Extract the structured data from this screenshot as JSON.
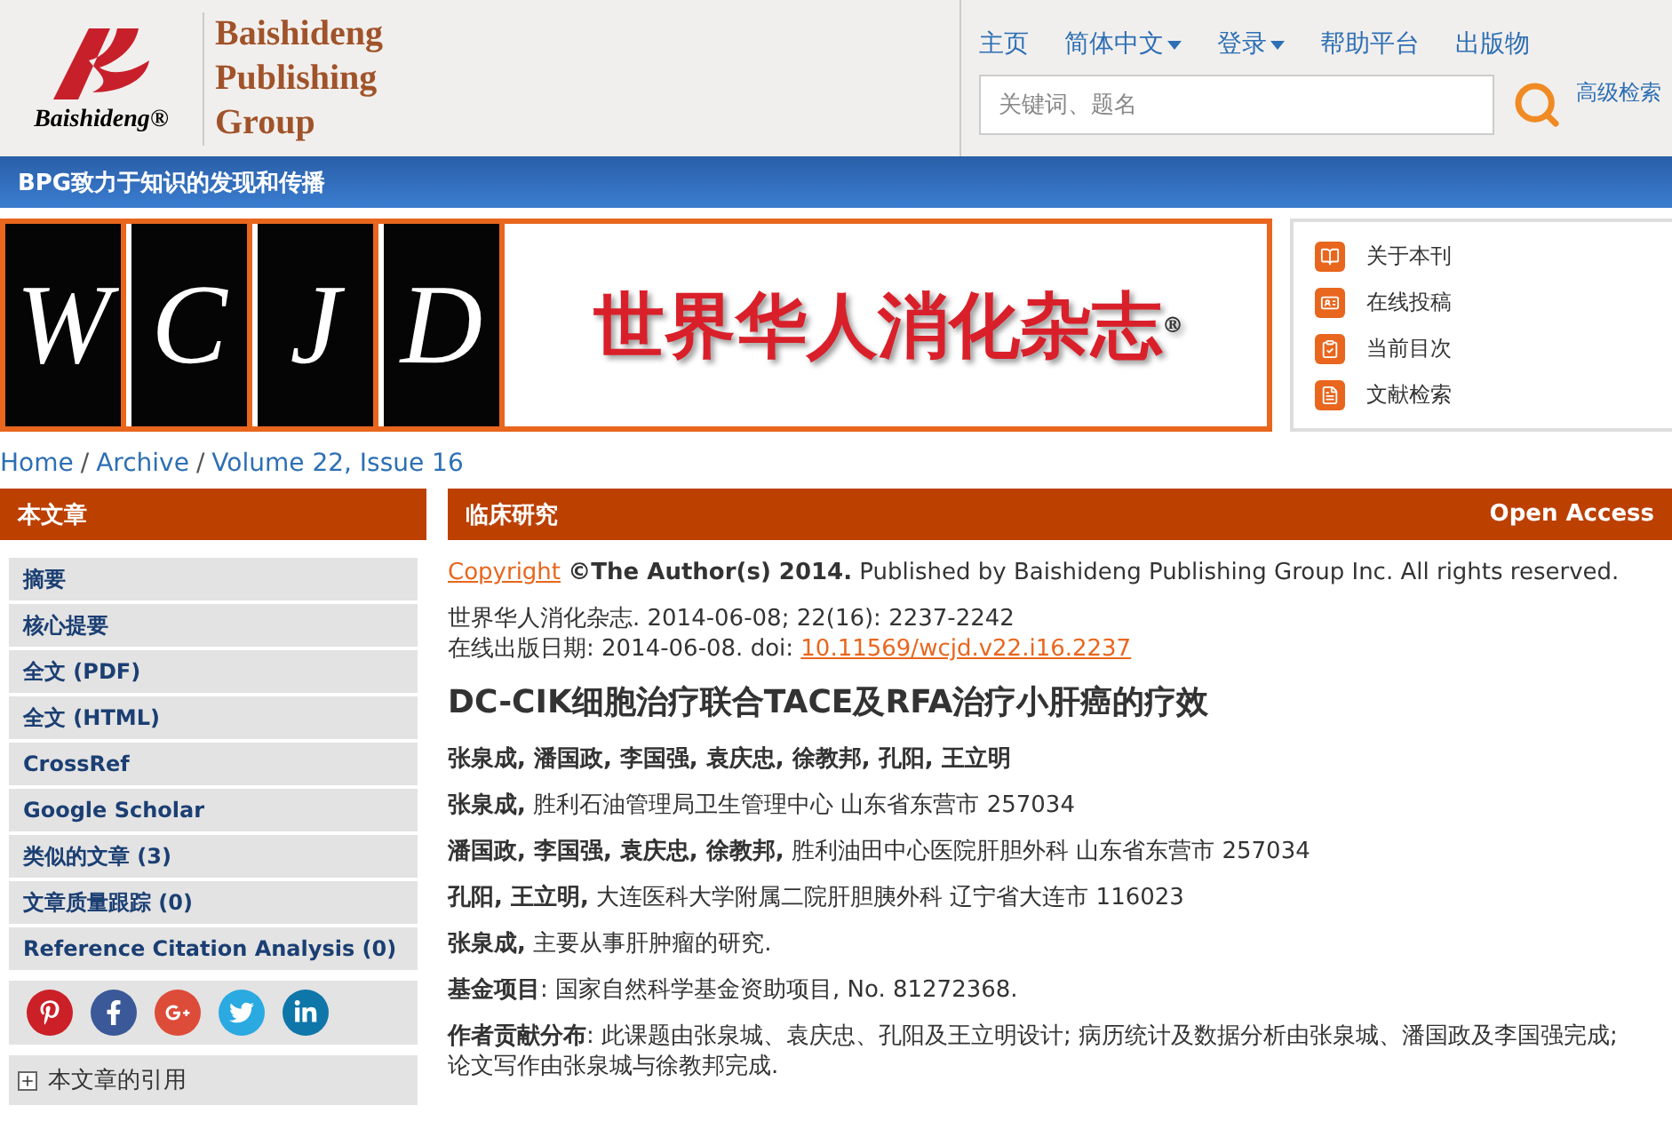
{
  "brand": {
    "logo_text": "Baishideng",
    "registered": "®",
    "name": [
      "Baishideng",
      "Publishing",
      "Group"
    ]
  },
  "nav": [
    {
      "label": "主页",
      "dropdown": false
    },
    {
      "label": "简体中文",
      "dropdown": true
    },
    {
      "label": "登录",
      "dropdown": true
    },
    {
      "label": "帮助平台",
      "dropdown": false
    },
    {
      "label": "出版物",
      "dropdown": false
    }
  ],
  "search": {
    "placeholder": "关键词、题名",
    "advanced": "高级检索"
  },
  "tagline": "BPG致力于知识的发现和传播",
  "banner": {
    "letters": [
      "W",
      "C",
      "J",
      "D"
    ],
    "title": "世界华人消化杂志",
    "registered": "®"
  },
  "journal_menu": [
    "关于本刊",
    "在线投稿",
    "当前目次",
    "文献检索"
  ],
  "breadcrumb": {
    "separator": "/",
    "items": [
      "Home",
      "Archive",
      "Volume 22, Issue 16"
    ]
  },
  "sidebar": {
    "title": "本文章",
    "items": [
      "摘要",
      "核心提要",
      "全文 (PDF)",
      "全文 (HTML)",
      "CrossRef",
      "Google Scholar",
      "类似的文章 (3)",
      "文章质量跟踪 (0)",
      "Reference Citation Analysis (0)"
    ],
    "sections": [
      {
        "label": "本文章的引用",
        "expanded": false
      }
    ]
  },
  "article": {
    "section": "临床研究",
    "access": "Open Access",
    "copyright_link": "Copyright",
    "copyright": "**©The Author(s) 2014.** Published by Baishideng Publishing Group Inc. All rights reserved.",
    "citation": "世界华人消化杂志. 2014-06-08; 22(16): 2237-2242",
    "online_date": "在线出版日期: 2014-06-08. doi: ",
    "doi": "10.11569/wcjd.v22.i16.2237",
    "title": "DC-CIK细胞治疗联合TACE及RFA治疗小肝癌的疗效",
    "paragraphs": [
      "**张泉成, 潘国政, 李国强, 袁庆忠, 徐教邦, 孔阳, 王立明**",
      "**张泉成,** 胜利石油管理局卫生管理中心 山东省东营市 257034",
      "**潘国政, 李国强, 袁庆忠, 徐教邦,** 胜利油田中心医院肝胆外科 山东省东营市 257034",
      "**孔阳, 王立明,** 大连医科大学附属二院肝胆胰外科 辽宁省大连市 116023",
      "**张泉成,** 主要从事肝肿瘤的研究.",
      "**基金项目**: 国家自然科学基金资助项目, No. 81272368.",
      "**作者贡献分布**: 此课题由张泉城、袁庆忠、孔阳及王立明设计; 病历统计及数据分析由张泉城、潘国政及李国强完成;",
      "论文写作由张泉城与徐教邦完成."
    ]
  }
}
